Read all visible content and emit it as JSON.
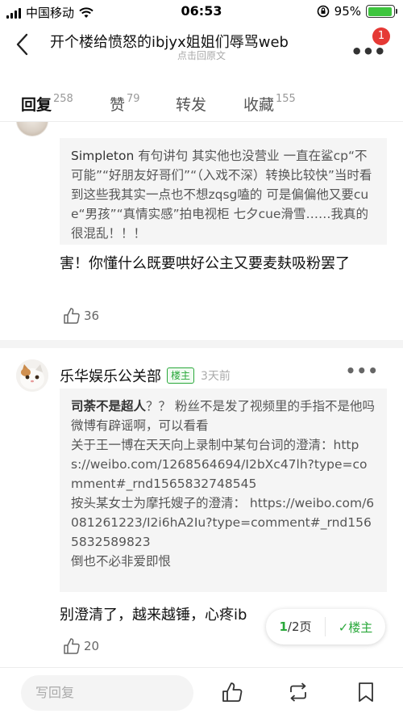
{
  "status_bar": {
    "carrier": "中国移动",
    "time": "06:53",
    "battery": "95%",
    "battery_level": 0.95
  },
  "nav": {
    "title": "开个楼给愤怒的ibjyx姐姐们辱骂web",
    "subtitle": "点击回原文",
    "notification_count": "1"
  },
  "tabs": [
    {
      "label": "回复",
      "count": "258"
    },
    {
      "label": "赞",
      "count": "79"
    },
    {
      "label": "转发",
      "count": ""
    },
    {
      "label": "收藏",
      "count": "155"
    }
  ],
  "comments": [
    {
      "quote_author": "Simpleton",
      "quote_text": "有句讲句 其实他也没营业 一直在鲨cp“不可能”“好朋友好哥们”“（入戏不深）转换比较快”当时看到这些我其实一点也不想zqsg嗑的 可是偏偏他又要cue“男孩”“真情实感”拍电视柜 七夕cue滑雪……我真的很混乱！！！",
      "text": "害！你懂什么既要哄好公主又要麦麸吸粉罢了",
      "likes": "36"
    },
    {
      "author": "乐华娱乐公关部",
      "tag": "楼主",
      "time": "3天前",
      "quote_author": "司荼不是超人",
      "quote_text": "？？ 粉丝不是发了视频里的手指不是他吗\n微博有辟谣啊，可以看看\n关于王一博在天天向上录制中某句台词的澄清：https://weibo.com/1268564694/I2bXc47lh?type=comment#_rnd1565832748545\n按头某女士为摩托嫂子的澄清： https://weibo.com/6081261223/I2i6hA2Iu?type=comment#_rnd1565832589823\n倒也不必非爱即恨",
      "text": "别澄清了，越来越锤，心疼ib",
      "likes": "20"
    }
  ],
  "pager": {
    "current": "1",
    "total": "/2页",
    "owner_only": "楼主",
    "check": "✓"
  },
  "bottom": {
    "reply_placeholder": "写回复"
  },
  "colors": {
    "accent_green": "#29a83a",
    "badge_red": "#e53935"
  }
}
